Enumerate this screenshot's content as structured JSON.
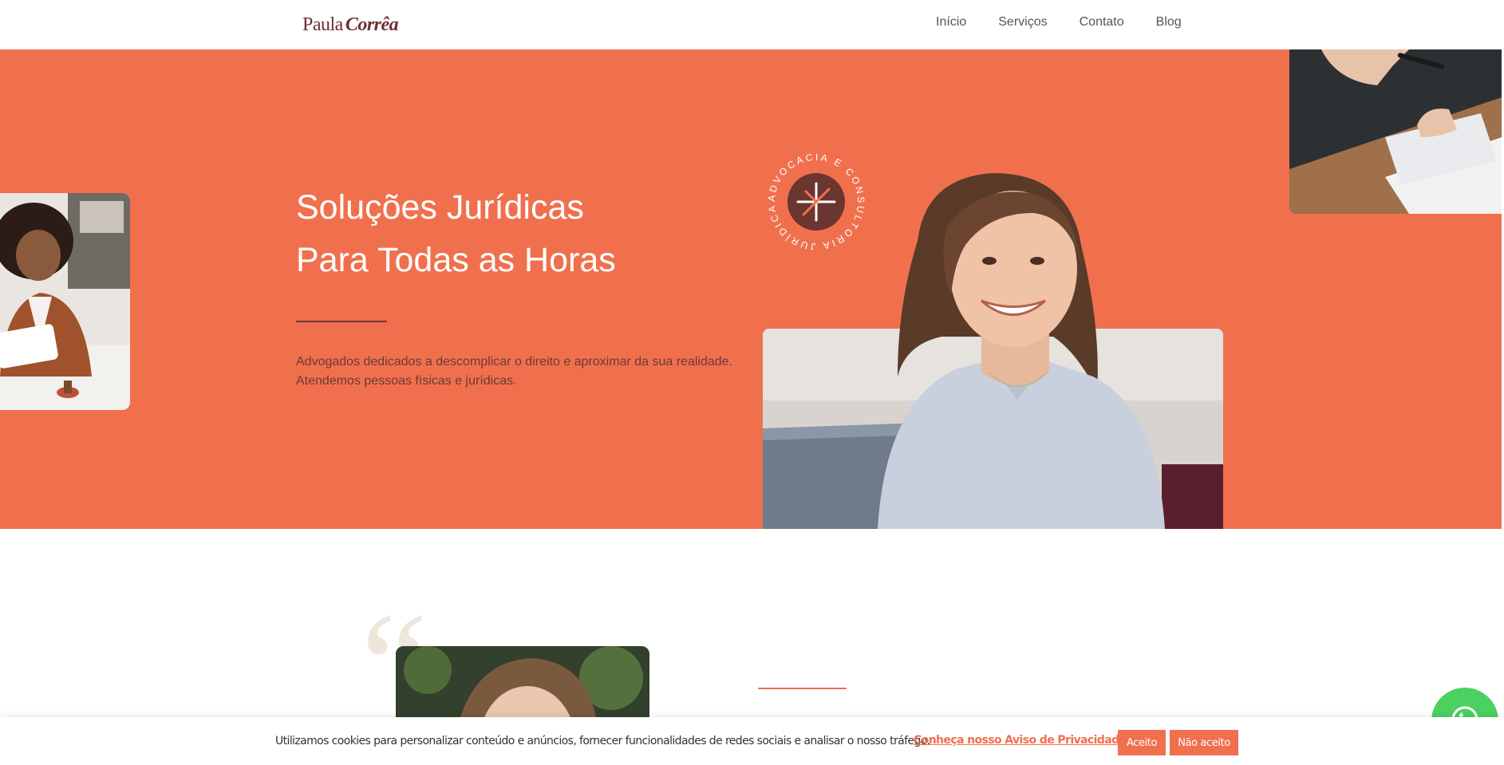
{
  "header": {
    "logo_light": "Paula",
    "logo_bold": "Corrêa",
    "nav": [
      "Início",
      "Serviços",
      "Contato",
      "Blog"
    ]
  },
  "hero": {
    "title_line1": "Soluções Jurídicas",
    "title_line2": "Para Todas as Horas",
    "text_line1": "Advogados dedicados a descomplicar o direito e aproximar da sua realidade.",
    "text_line2": "Atendemos pessoas físicas e jurídicas.",
    "badge_text": "ADVOCACIA E CONSULTORIA JURÍDICA",
    "background_color": "#f0704e"
  },
  "lower": {
    "quote_mark": "“"
  },
  "cookie": {
    "text": "Utilizamos cookies para personalizar conteúdo e anúncios, fornecer funcionalidades de redes sociais e analisar o nosso tráfego.",
    "link": "Conheça nosso Aviso de Privacidade",
    "accept": "Aceito",
    "reject": "Não aceito"
  },
  "colors": {
    "accent": "#f0704e",
    "brand_dark": "#6b3030",
    "whatsapp": "#4cd160"
  }
}
